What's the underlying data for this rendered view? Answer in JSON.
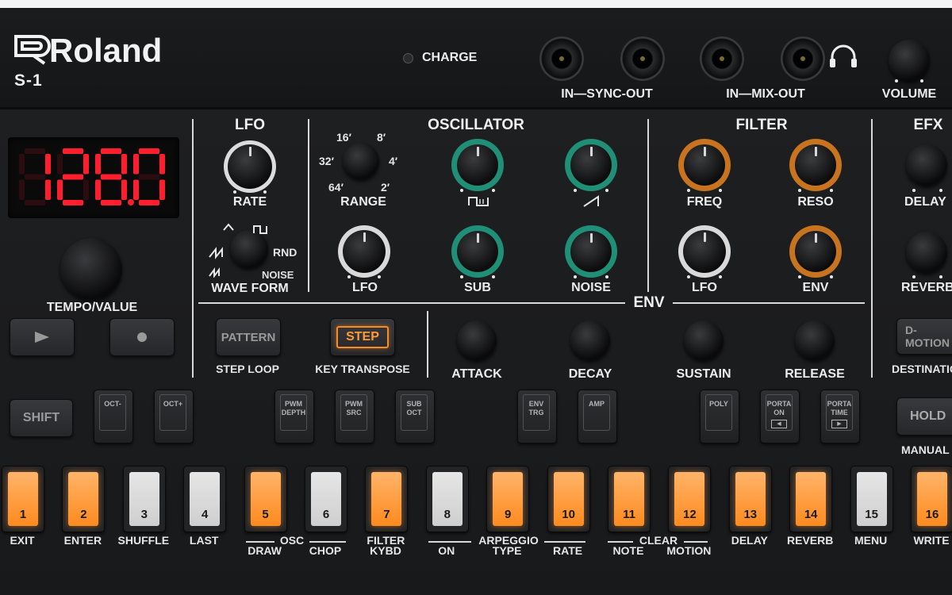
{
  "brand": {
    "name": "Roland",
    "model": "S-1"
  },
  "top": {
    "charge": "CHARGE",
    "sync": "IN—SYNC-OUT",
    "mix": "IN—MIX-OUT",
    "volume": "VOLUME",
    "headphones_icon": "headphones-icon"
  },
  "display": {
    "value": "128.0",
    "color": "#ff1e2e"
  },
  "tempo": {
    "label": "TEMPO/VALUE",
    "play_icon": "play-icon",
    "rec_icon": "record-icon"
  },
  "sections": {
    "lfo": "LFO",
    "oscillator": "OSCILLATOR",
    "filter": "FILTER",
    "efx": "EFX",
    "env": "ENV"
  },
  "lfo": {
    "rate": "RATE",
    "waveform": "WAVE FORM",
    "rnd": "RND",
    "noise": "NOISE"
  },
  "osc": {
    "range": "RANGE",
    "range_marks": [
      "16′",
      "8′",
      "32′",
      "4′",
      "64′",
      "2′"
    ],
    "lfo": "LFO",
    "sub": "SUB",
    "noise": "NOISE"
  },
  "filter": {
    "freq": "FREQ",
    "reso": "RESO",
    "lfo": "LFO",
    "env": "ENV"
  },
  "efx": {
    "delay": "DELAY",
    "reverb": "REVERB",
    "dmotion": "D-MOTION",
    "destination": "DESTINATION",
    "hold": "HOLD",
    "manual": "MANUAL"
  },
  "env": {
    "attack": "ATTACK",
    "decay": "DECAY",
    "sustain": "SUSTAIN",
    "release": "RELEASE"
  },
  "mode": {
    "pattern": "PATTERN",
    "step_loop": "STEP LOOP",
    "step": "STEP",
    "key_transpose": "KEY TRANSPOSE"
  },
  "shift": "SHIFT",
  "func_buttons": [
    {
      "l1": "OCT-",
      "l2": ""
    },
    {
      "l1": "OCT+",
      "l2": ""
    },
    {
      "l1": "PWM",
      "l2": "DEPTH"
    },
    {
      "l1": "PWM",
      "l2": "SRC"
    },
    {
      "l1": "SUB",
      "l2": "OCT"
    },
    {
      "l1": "ENV",
      "l2": "TRG"
    },
    {
      "l1": "AMP",
      "l2": ""
    },
    {
      "l1": "POLY",
      "l2": ""
    },
    {
      "l1": "PORTA",
      "l2": "ON"
    },
    {
      "l1": "PORTA",
      "l2": "TIME"
    }
  ],
  "steps": [
    {
      "num": "1",
      "lit": "orange",
      "label": "EXIT"
    },
    {
      "num": "2",
      "lit": "orange",
      "label": "ENTER"
    },
    {
      "num": "3",
      "lit": "white",
      "label": "SHUFFLE"
    },
    {
      "num": "4",
      "lit": "white",
      "label": "LAST"
    },
    {
      "num": "5",
      "lit": "orange",
      "label": "DRAW"
    },
    {
      "num": "6",
      "lit": "white",
      "label": "CHOP"
    },
    {
      "num": "7",
      "lit": "orange",
      "label": "FILTER"
    },
    {
      "num": "8",
      "lit": "white",
      "label": "ON"
    },
    {
      "num": "9",
      "lit": "orange",
      "label": "TYPE"
    },
    {
      "num": "10",
      "lit": "orange",
      "label": "RATE"
    },
    {
      "num": "11",
      "lit": "orange",
      "label": "NOTE"
    },
    {
      "num": "12",
      "lit": "orange",
      "label": "MOTION"
    },
    {
      "num": "13",
      "lit": "orange",
      "label": "DELAY"
    },
    {
      "num": "14",
      "lit": "orange",
      "label": "REVERB"
    },
    {
      "num": "15",
      "lit": "white",
      "label": "MENU"
    },
    {
      "num": "16",
      "lit": "orange",
      "label": "WRITE"
    }
  ],
  "group_labels": {
    "osc": "OSC",
    "kybd": "KYBD",
    "arpeggio": "ARPEGGIO",
    "clear": "CLEAR"
  },
  "colors": {
    "green_ring": "#1f8f78",
    "orange_ring": "#c8741e",
    "white_ring": "#d9d9d9",
    "step_orange": "#ff8a1e",
    "step_white": "#d6d6d6"
  }
}
